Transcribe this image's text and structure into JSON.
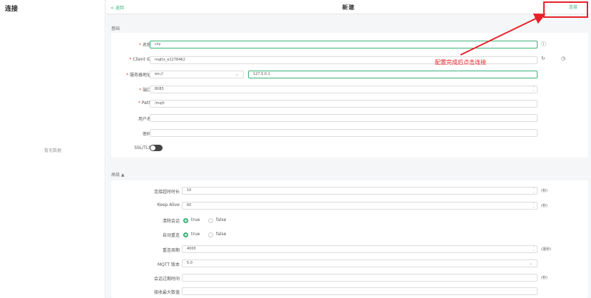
{
  "sidebar": {
    "title": "连接",
    "empty_text": "暂无数据"
  },
  "topbar": {
    "back_label": "< 返回",
    "title": "新建",
    "connect_label": "连接"
  },
  "annotation": {
    "text": "配置完成后点击连接"
  },
  "basic": {
    "section_label": "基础",
    "name": {
      "label": "名称",
      "value": "czy"
    },
    "client_id": {
      "label": "Client ID",
      "value": "mqttx_e1278462"
    },
    "host": {
      "label": "服务器地址",
      "protocol": "ws://",
      "value": "127.0.0.1"
    },
    "port": {
      "label": "端口",
      "value": "8083"
    },
    "path": {
      "label": "Path",
      "value": "/mqtt"
    },
    "username": {
      "label": "用户名",
      "value": ""
    },
    "password": {
      "label": "密码",
      "value": ""
    },
    "ssl": {
      "label": "SSL/TLS",
      "enabled": false
    }
  },
  "advanced": {
    "section_label": "高级 ▲",
    "connect_timeout": {
      "label": "连接超时时长",
      "value": "10",
      "unit": "(秒)"
    },
    "keep_alive": {
      "label": "Keep Alive",
      "value": "60",
      "unit": "(秒)"
    },
    "clean_session": {
      "label": "清除会话",
      "true_label": "true",
      "false_label": "false",
      "selected": "true"
    },
    "auto_reconnect": {
      "label": "自动重连",
      "true_label": "true",
      "false_label": "false",
      "selected": "true"
    },
    "reconnect_period": {
      "label": "重连周期",
      "value": "4000",
      "unit": "(毫秒)"
    },
    "mqtt_version": {
      "label": "MQTT 版本",
      "value": "5.0"
    },
    "session_expiry": {
      "label": "会话过期时间",
      "value": "",
      "unit": "(秒)"
    },
    "receive_maximum": {
      "label": "接收最大数值",
      "value": ""
    }
  },
  "icons": {
    "info": "info-circle-icon",
    "refresh": "refresh-icon",
    "clock": "clock-icon",
    "chevron": "chevron-down-icon",
    "stepper": "stepper-arrows-icon"
  },
  "colors": {
    "accent": "#3bb07a",
    "highlight": "#e8202a",
    "required": "#e0434b"
  }
}
